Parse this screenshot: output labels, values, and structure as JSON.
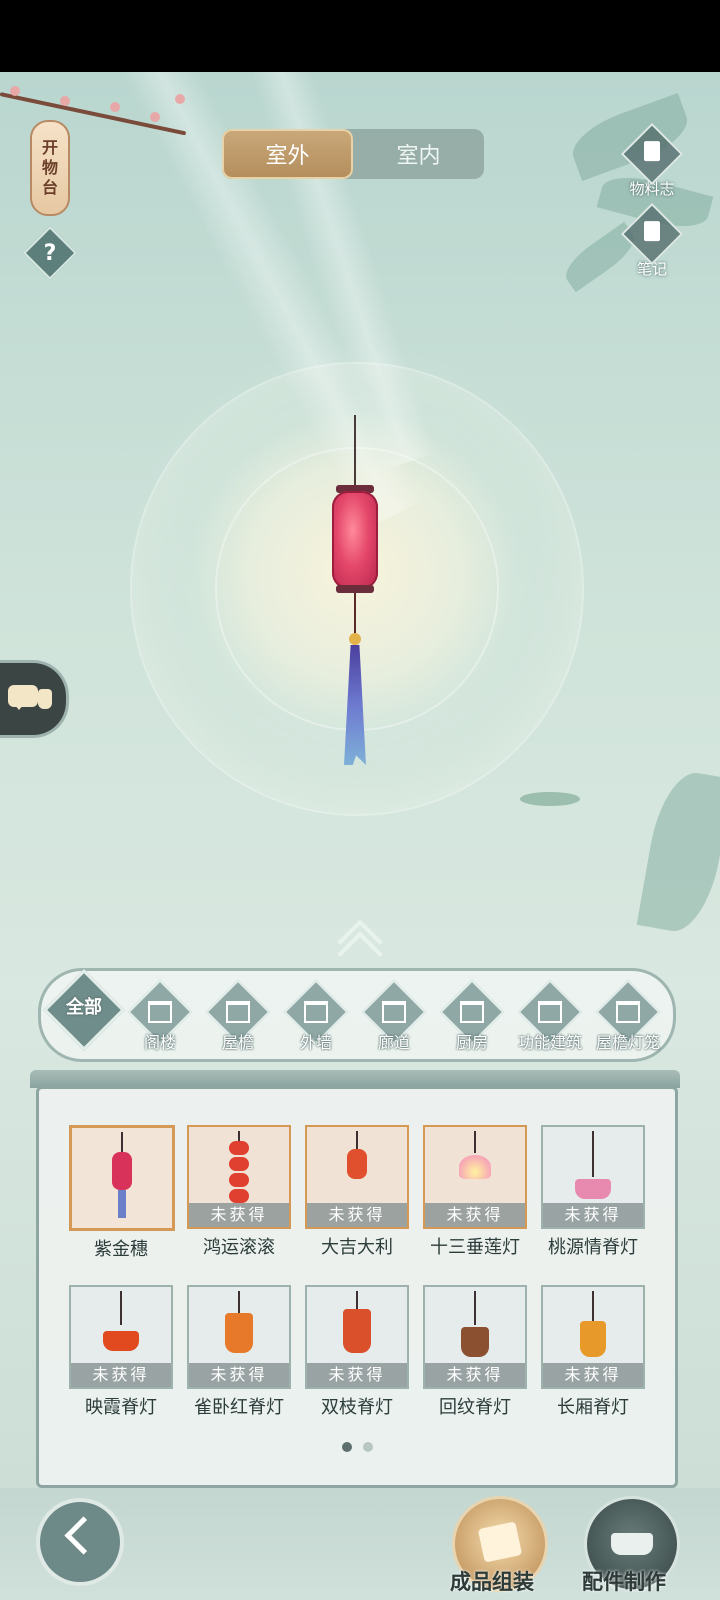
{
  "tabs": [
    {
      "label": "室外",
      "active": true
    },
    {
      "label": "室内",
      "active": false
    }
  ],
  "left_panel": {
    "shelf_button_chars": [
      "开",
      "物",
      "台"
    ],
    "help_icon_label": "?"
  },
  "right_tools": [
    {
      "label": "物料志",
      "icon": "book-icon"
    },
    {
      "label": "笔记",
      "icon": "note-icon"
    }
  ],
  "categories": [
    {
      "label": "全部",
      "icon": "all-icon",
      "selected": true
    },
    {
      "label": "阁楼",
      "icon": "pavilion-icon"
    },
    {
      "label": "屋檐",
      "icon": "eave-icon"
    },
    {
      "label": "外墙",
      "icon": "wall-icon"
    },
    {
      "label": "廊道",
      "icon": "corridor-icon"
    },
    {
      "label": "厨房",
      "icon": "kitchen-icon"
    },
    {
      "label": "功能建筑",
      "icon": "building-icon"
    },
    {
      "label": "屋檐灯笼",
      "icon": "lantern-icon"
    }
  ],
  "items": [
    {
      "name": "紫金穗",
      "locked": false,
      "selected": true
    },
    {
      "name": "鸿运滚滚",
      "locked": true,
      "locked_label": "未获得"
    },
    {
      "name": "大吉大利",
      "locked": true,
      "locked_label": "未获得"
    },
    {
      "name": "十三垂莲灯",
      "locked": true,
      "locked_label": "未获得"
    },
    {
      "name": "桃源情脊灯",
      "locked": true,
      "locked_label": "未获得"
    },
    {
      "name": "映霞脊灯",
      "locked": true,
      "locked_label": "未获得"
    },
    {
      "name": "雀卧红脊灯",
      "locked": true,
      "locked_label": "未获得"
    },
    {
      "name": "双枝脊灯",
      "locked": true,
      "locked_label": "未获得"
    },
    {
      "name": "回纹脊灯",
      "locked": true,
      "locked_label": "未获得"
    },
    {
      "name": "长厢脊灯",
      "locked": true,
      "locked_label": "未获得"
    }
  ],
  "pagination": {
    "current": 1,
    "total": 2
  },
  "bottom_actions": [
    {
      "label": "成品组装",
      "icon": "assembly-icon"
    },
    {
      "label": "配件制作",
      "icon": "craft-icon"
    }
  ],
  "colors": {
    "accent_gold": "#c2a06f",
    "lantern_red": "#e4476a",
    "scene_bg": "#cfe3da",
    "panel_border": "#8ea6a1"
  }
}
